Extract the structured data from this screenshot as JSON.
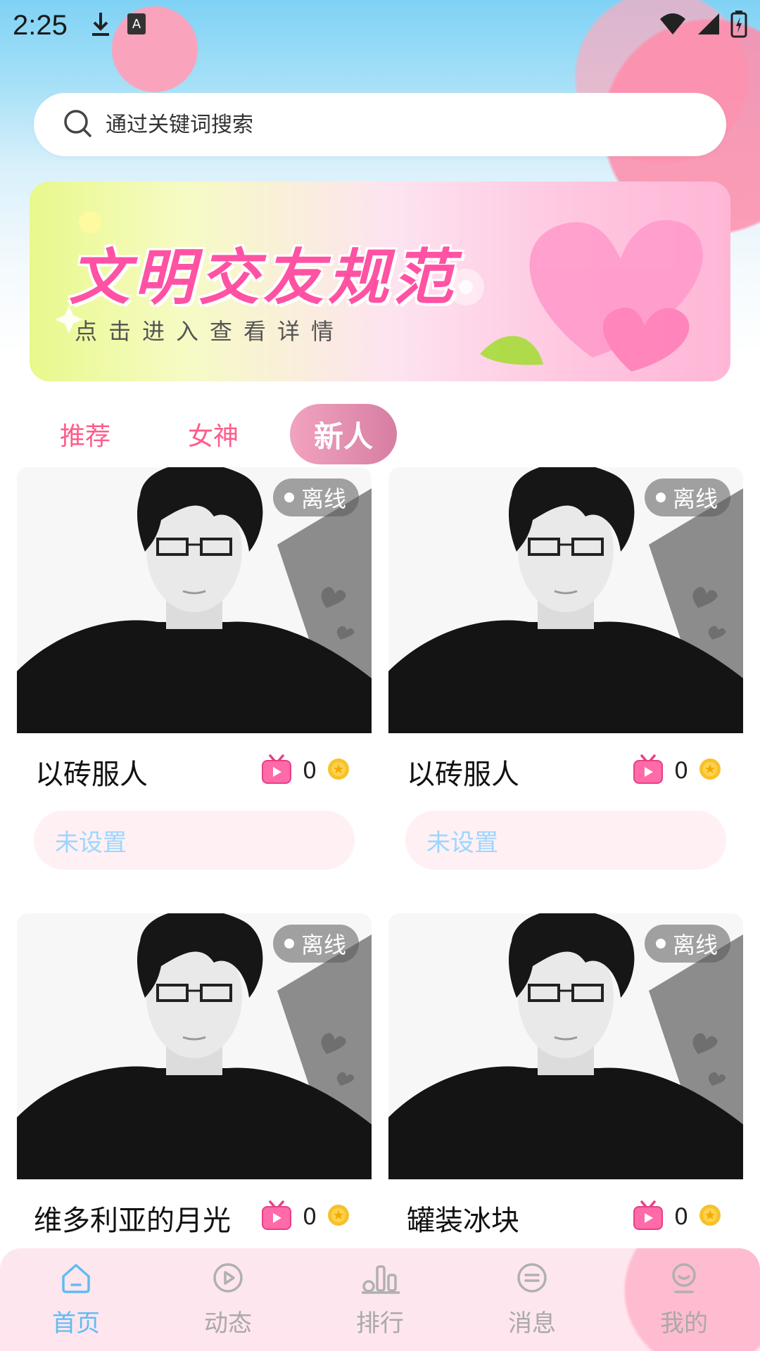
{
  "status_bar": {
    "time": "2:25"
  },
  "search": {
    "placeholder": "通过关键词搜索"
  },
  "banner": {
    "title": "文明交友规范",
    "subtitle": "点击进入查看详情"
  },
  "tabs": [
    {
      "label": "推荐",
      "active": false
    },
    {
      "label": "女神",
      "active": false
    },
    {
      "label": "新人",
      "active": true
    }
  ],
  "cards": [
    {
      "name": "以砖服人",
      "status": "离线",
      "count": "0",
      "tag": "未设置"
    },
    {
      "name": "以砖服人",
      "status": "离线",
      "count": "0",
      "tag": "未设置"
    },
    {
      "name": "维多利亚的月光",
      "status": "离线",
      "count": "0"
    },
    {
      "name": "罐装冰块",
      "status": "离线",
      "count": "0"
    }
  ],
  "bottom_nav": [
    {
      "label": "首页",
      "icon": "home-icon",
      "active": true
    },
    {
      "label": "动态",
      "icon": "play-icon",
      "active": false
    },
    {
      "label": "排行",
      "icon": "ranking-icon",
      "active": false
    },
    {
      "label": "消息",
      "icon": "message-icon",
      "active": false
    },
    {
      "label": "我的",
      "icon": "profile-icon",
      "active": false
    }
  ],
  "colors": {
    "accent_pink": "#ff5c8a",
    "active_tab_gradient": "#e291b1",
    "nav_active": "#5fbcf2",
    "tag_text": "#9bd6ff"
  }
}
